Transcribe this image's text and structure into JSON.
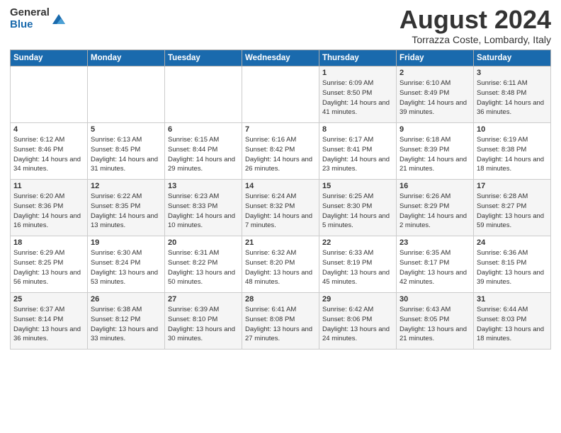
{
  "logo": {
    "general": "General",
    "blue": "Blue"
  },
  "title": "August 2024",
  "location": "Torrazza Coste, Lombardy, Italy",
  "days_of_week": [
    "Sunday",
    "Monday",
    "Tuesday",
    "Wednesday",
    "Thursday",
    "Friday",
    "Saturday"
  ],
  "weeks": [
    [
      {
        "day": "",
        "content": ""
      },
      {
        "day": "",
        "content": ""
      },
      {
        "day": "",
        "content": ""
      },
      {
        "day": "",
        "content": ""
      },
      {
        "day": "1",
        "content": "Sunrise: 6:09 AM\nSunset: 8:50 PM\nDaylight: 14 hours and 41 minutes."
      },
      {
        "day": "2",
        "content": "Sunrise: 6:10 AM\nSunset: 8:49 PM\nDaylight: 14 hours and 39 minutes."
      },
      {
        "day": "3",
        "content": "Sunrise: 6:11 AM\nSunset: 8:48 PM\nDaylight: 14 hours and 36 minutes."
      }
    ],
    [
      {
        "day": "4",
        "content": "Sunrise: 6:12 AM\nSunset: 8:46 PM\nDaylight: 14 hours and 34 minutes."
      },
      {
        "day": "5",
        "content": "Sunrise: 6:13 AM\nSunset: 8:45 PM\nDaylight: 14 hours and 31 minutes."
      },
      {
        "day": "6",
        "content": "Sunrise: 6:15 AM\nSunset: 8:44 PM\nDaylight: 14 hours and 29 minutes."
      },
      {
        "day": "7",
        "content": "Sunrise: 6:16 AM\nSunset: 8:42 PM\nDaylight: 14 hours and 26 minutes."
      },
      {
        "day": "8",
        "content": "Sunrise: 6:17 AM\nSunset: 8:41 PM\nDaylight: 14 hours and 23 minutes."
      },
      {
        "day": "9",
        "content": "Sunrise: 6:18 AM\nSunset: 8:39 PM\nDaylight: 14 hours and 21 minutes."
      },
      {
        "day": "10",
        "content": "Sunrise: 6:19 AM\nSunset: 8:38 PM\nDaylight: 14 hours and 18 minutes."
      }
    ],
    [
      {
        "day": "11",
        "content": "Sunrise: 6:20 AM\nSunset: 8:36 PM\nDaylight: 14 hours and 16 minutes."
      },
      {
        "day": "12",
        "content": "Sunrise: 6:22 AM\nSunset: 8:35 PM\nDaylight: 14 hours and 13 minutes."
      },
      {
        "day": "13",
        "content": "Sunrise: 6:23 AM\nSunset: 8:33 PM\nDaylight: 14 hours and 10 minutes."
      },
      {
        "day": "14",
        "content": "Sunrise: 6:24 AM\nSunset: 8:32 PM\nDaylight: 14 hours and 7 minutes."
      },
      {
        "day": "15",
        "content": "Sunrise: 6:25 AM\nSunset: 8:30 PM\nDaylight: 14 hours and 5 minutes."
      },
      {
        "day": "16",
        "content": "Sunrise: 6:26 AM\nSunset: 8:29 PM\nDaylight: 14 hours and 2 minutes."
      },
      {
        "day": "17",
        "content": "Sunrise: 6:28 AM\nSunset: 8:27 PM\nDaylight: 13 hours and 59 minutes."
      }
    ],
    [
      {
        "day": "18",
        "content": "Sunrise: 6:29 AM\nSunset: 8:25 PM\nDaylight: 13 hours and 56 minutes."
      },
      {
        "day": "19",
        "content": "Sunrise: 6:30 AM\nSunset: 8:24 PM\nDaylight: 13 hours and 53 minutes."
      },
      {
        "day": "20",
        "content": "Sunrise: 6:31 AM\nSunset: 8:22 PM\nDaylight: 13 hours and 50 minutes."
      },
      {
        "day": "21",
        "content": "Sunrise: 6:32 AM\nSunset: 8:20 PM\nDaylight: 13 hours and 48 minutes."
      },
      {
        "day": "22",
        "content": "Sunrise: 6:33 AM\nSunset: 8:19 PM\nDaylight: 13 hours and 45 minutes."
      },
      {
        "day": "23",
        "content": "Sunrise: 6:35 AM\nSunset: 8:17 PM\nDaylight: 13 hours and 42 minutes."
      },
      {
        "day": "24",
        "content": "Sunrise: 6:36 AM\nSunset: 8:15 PM\nDaylight: 13 hours and 39 minutes."
      }
    ],
    [
      {
        "day": "25",
        "content": "Sunrise: 6:37 AM\nSunset: 8:14 PM\nDaylight: 13 hours and 36 minutes."
      },
      {
        "day": "26",
        "content": "Sunrise: 6:38 AM\nSunset: 8:12 PM\nDaylight: 13 hours and 33 minutes."
      },
      {
        "day": "27",
        "content": "Sunrise: 6:39 AM\nSunset: 8:10 PM\nDaylight: 13 hours and 30 minutes."
      },
      {
        "day": "28",
        "content": "Sunrise: 6:41 AM\nSunset: 8:08 PM\nDaylight: 13 hours and 27 minutes."
      },
      {
        "day": "29",
        "content": "Sunrise: 6:42 AM\nSunset: 8:06 PM\nDaylight: 13 hours and 24 minutes."
      },
      {
        "day": "30",
        "content": "Sunrise: 6:43 AM\nSunset: 8:05 PM\nDaylight: 13 hours and 21 minutes."
      },
      {
        "day": "31",
        "content": "Sunrise: 6:44 AM\nSunset: 8:03 PM\nDaylight: 13 hours and 18 minutes."
      }
    ]
  ]
}
